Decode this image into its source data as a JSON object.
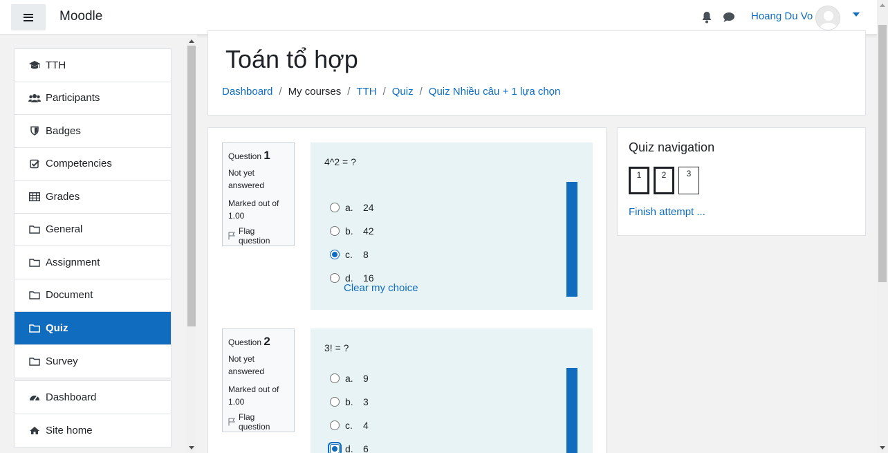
{
  "navbar": {
    "brand": "Moodle",
    "user_name": "Hoang Du Vo",
    "icons": [
      "menu-icon",
      "bell-icon",
      "chat-icon",
      "avatar",
      "caret-down-icon"
    ]
  },
  "sidebar": {
    "group1": [
      {
        "label": "TTH",
        "icon": "graduation-cap-icon"
      },
      {
        "label": "Participants",
        "icon": "users-icon"
      },
      {
        "label": "Badges",
        "icon": "shield-icon"
      },
      {
        "label": "Competencies",
        "icon": "check-square-icon"
      },
      {
        "label": "Grades",
        "icon": "table-icon"
      },
      {
        "label": "General",
        "icon": "folder-icon"
      },
      {
        "label": "Assignment",
        "icon": "folder-icon"
      },
      {
        "label": "Document",
        "icon": "folder-icon"
      },
      {
        "label": "Quiz",
        "icon": "folder-icon",
        "active": true
      },
      {
        "label": "Survey",
        "icon": "folder-icon"
      }
    ],
    "group2": [
      {
        "label": "Dashboard",
        "icon": "tachometer-icon"
      },
      {
        "label": "Site home",
        "icon": "home-icon"
      }
    ]
  },
  "header": {
    "title": "Toán tổ hợp",
    "breadcrumb": [
      {
        "label": "Dashboard",
        "link": true
      },
      {
        "label": "My courses",
        "link": false
      },
      {
        "label": "TTH",
        "link": true
      },
      {
        "label": "Quiz",
        "link": true
      },
      {
        "label": "Quiz Nhiều câu + 1 lựa chọn",
        "link": true
      }
    ]
  },
  "questions": [
    {
      "label": "Question",
      "number": "1",
      "state": "Not yet answered",
      "marked": "Marked out of 1.00",
      "flag_label": "Flag question",
      "text": "4^2 = ?",
      "answers": [
        {
          "letter": "a.",
          "value": "24",
          "checked": false
        },
        {
          "letter": "b.",
          "value": "42",
          "checked": false
        },
        {
          "letter": "c.",
          "value": "8",
          "checked": true
        },
        {
          "letter": "d.",
          "value": "16",
          "checked": false
        }
      ],
      "clear_label": "Clear my choice"
    },
    {
      "label": "Question",
      "number": "2",
      "state": "Not yet answered",
      "marked": "Marked out of 1.00",
      "flag_label": "Flag question",
      "text": "3! = ?",
      "answers": [
        {
          "letter": "a.",
          "value": "9",
          "checked": false
        },
        {
          "letter": "b.",
          "value": "3",
          "checked": false
        },
        {
          "letter": "c.",
          "value": "4",
          "checked": false
        },
        {
          "letter": "d.",
          "value": "6",
          "checked": true
        }
      ]
    }
  ],
  "quiz_nav": {
    "title": "Quiz navigation",
    "buttons": [
      {
        "label": "1",
        "answered": true
      },
      {
        "label": "2",
        "answered": true
      },
      {
        "label": "3",
        "answered": false
      }
    ],
    "finish_label": "Finish attempt ..."
  },
  "colors": {
    "primary": "#0f6cbf",
    "question_bg": "#e7f3f5",
    "text": "#1d2125"
  }
}
